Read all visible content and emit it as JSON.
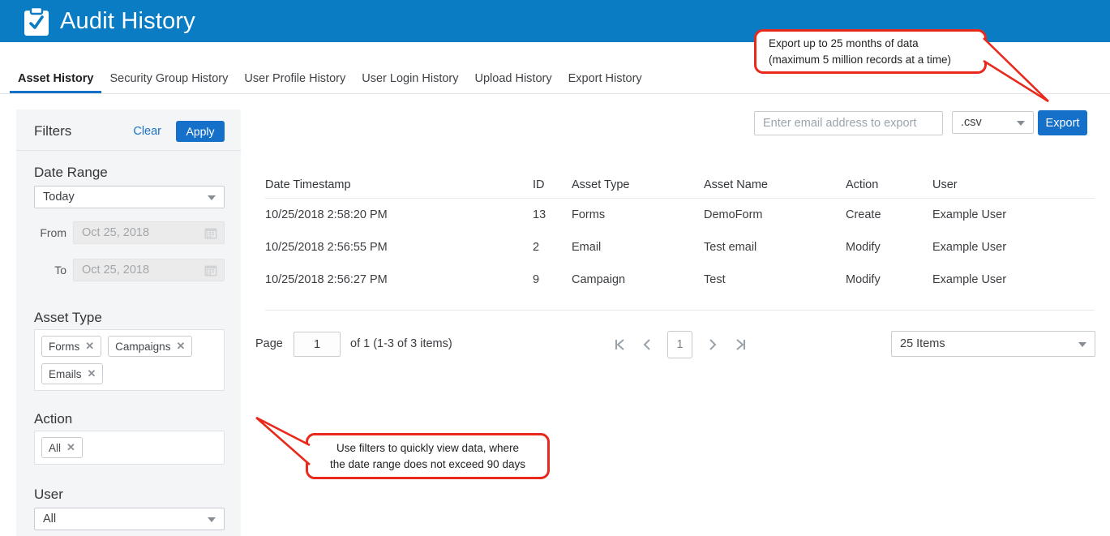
{
  "colors": {
    "header_bg": "#0a7cc4",
    "button_blue": "#1470c8",
    "link_blue": "#1b72c8",
    "active_tab_underline": "#1470c8",
    "callout_red": "#e8291c",
    "sidebar_bg": "#f3f5f7",
    "disabled_field_bg": "#ebebeb"
  },
  "icons": {
    "remove_glyph": "✕",
    "header_icon": "clipboard-check",
    "date_icon": "calendar",
    "dropdown_icon": "caret-down",
    "pager_icons": [
      "first-page",
      "previous-page",
      "next-page",
      "last-page"
    ]
  },
  "header": {
    "title": "Audit History"
  },
  "tabs": [
    {
      "label": "Asset History",
      "active": true
    },
    {
      "label": "Security Group History",
      "active": false
    },
    {
      "label": "User Profile History",
      "active": false
    },
    {
      "label": "User Login History",
      "active": false
    },
    {
      "label": "Upload History",
      "active": false
    },
    {
      "label": "Export History",
      "active": false
    }
  ],
  "export_bar": {
    "email_placeholder": "Enter email address to export",
    "format_value": ".csv",
    "export_label": "Export"
  },
  "filters": {
    "title": "Filters",
    "clear_label": "Clear",
    "apply_label": "Apply",
    "date_range": {
      "label": "Date Range",
      "value": "Today"
    },
    "from": {
      "label": "From",
      "value": "Oct 25, 2018"
    },
    "to": {
      "label": "To",
      "value": "Oct 25, 2018"
    },
    "asset_type": {
      "label": "Asset Type",
      "chips": [
        "Forms",
        "Campaigns",
        "Emails"
      ]
    },
    "action": {
      "label": "Action",
      "chips": [
        "All"
      ]
    },
    "user": {
      "label": "User",
      "value": "All"
    }
  },
  "table": {
    "columns": [
      "Date Timestamp",
      "ID",
      "Asset Type",
      "Asset Name",
      "Action",
      "User"
    ],
    "rows": [
      [
        "10/25/2018 2:58:20 PM",
        "13",
        "Forms",
        "DemoForm",
        "Create",
        "Example User"
      ],
      [
        "10/25/2018 2:56:55 PM",
        "2",
        "Email",
        "Test email",
        "Modify",
        "Example User"
      ],
      [
        "10/25/2018 2:56:27 PM",
        "9",
        "Campaign",
        "Test",
        "Modify",
        "Example User"
      ]
    ]
  },
  "pagination": {
    "page_label": "Page",
    "page_input": "1",
    "range_text": "of 1 (1-3 of 3 items)",
    "current_page": "1",
    "items_per_page": "25 Items"
  },
  "callouts": {
    "export": {
      "line1": "Export up to 25 months of data",
      "line2": "(maximum 5 million records at a time)"
    },
    "filters": {
      "line1": "Use filters to quickly view data, where",
      "line2": "the date range does not exceed 90 days"
    }
  }
}
